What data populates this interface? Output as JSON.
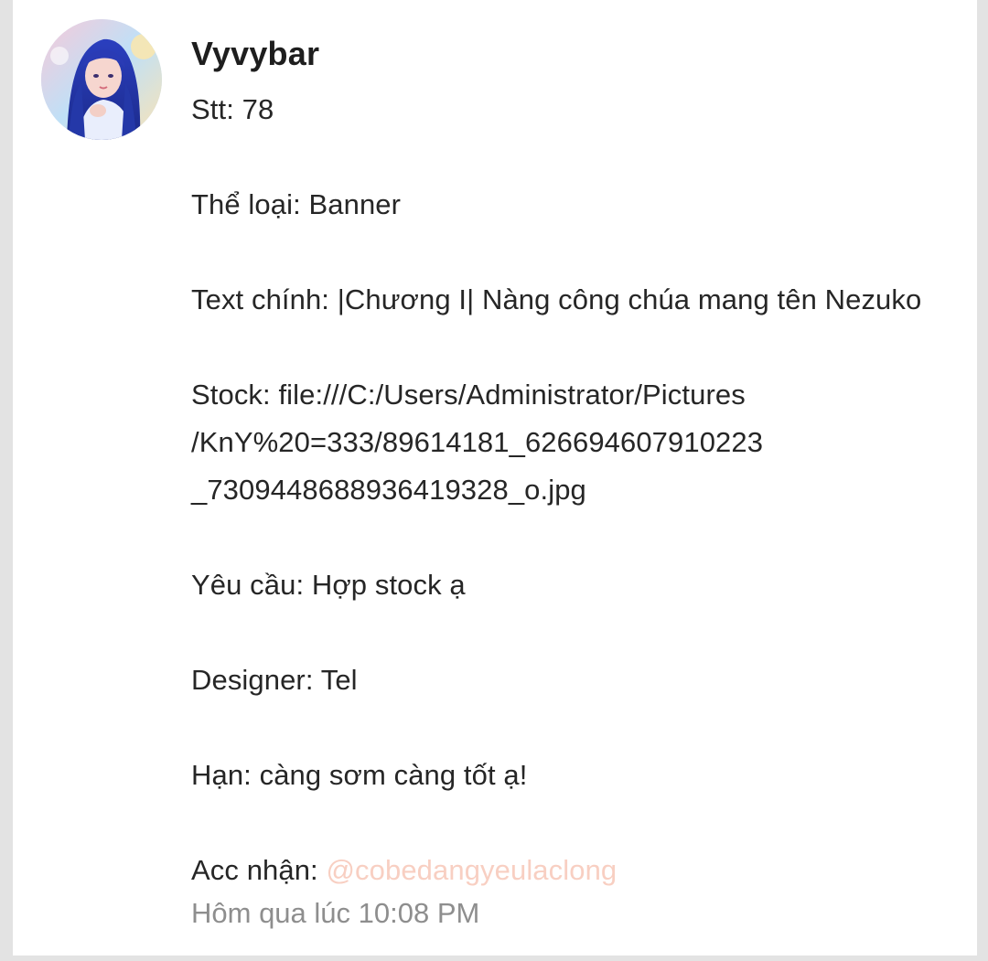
{
  "post": {
    "username": "Vyvybar",
    "avatar_icon": "user-avatar-anime-girl",
    "lines": {
      "stt": "Stt: 78",
      "the_loai": "Thể loại: Banner",
      "text_chinh": "Text chính: |Chương I| Nàng công chúa mang tên Nezuko",
      "stock_1": "Stock: file:///C:/Users/Administrator/Pictures",
      "stock_2": "/KnY%20=333/89614181_626694607910223",
      "stock_3": "_7309448688936419328_o.jpg",
      "yeu_cau": "Yêu cầu: Hợp stock ạ",
      "designer": "Designer: Tel",
      "han": "Hạn: càng sơm càng tốt ạ!",
      "acc_nhan_label": "Acc nhận: ",
      "acc_nhan_mention": "@cobedangyeulaclong"
    },
    "timestamp": "Hôm qua lúc 10:08 PM"
  },
  "colors": {
    "background": "#e3e3e3",
    "card": "#ffffff",
    "text": "#262626",
    "mention": "#f8cfc2",
    "timestamp": "#8e8e8e"
  }
}
